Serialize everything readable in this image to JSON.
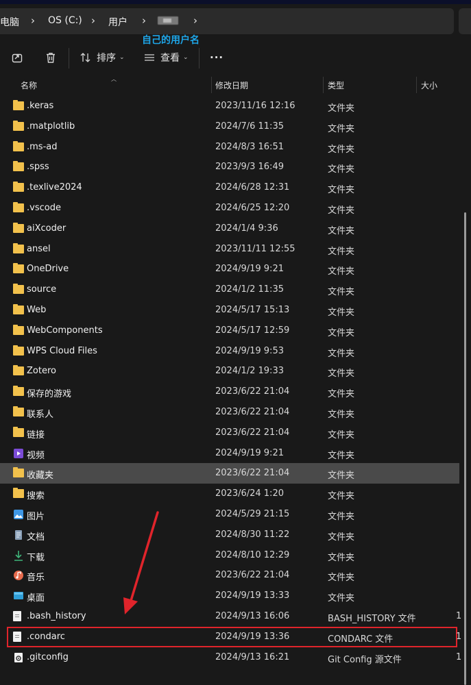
{
  "breadcrumb": {
    "items": [
      "电脑",
      "OS (C:)",
      "用户"
    ],
    "separator": "›"
  },
  "annotation": {
    "label": "自己的用户名"
  },
  "toolbar": {
    "sort_label": "排序",
    "view_label": "查看",
    "more_label": "···"
  },
  "columns": {
    "name": "名称",
    "date": "修改日期",
    "type": "类型",
    "size": "大小"
  },
  "colors": {
    "folder": "#f2c14c",
    "accent": "#1ea5e8",
    "highlight": "#e0242b",
    "selected_row": "#4a4a4a"
  },
  "rows": [
    {
      "name": ".keras",
      "date": "2023/11/16 12:16",
      "type": "文件夹",
      "size": "",
      "icon": "folder-icon"
    },
    {
      "name": ".matplotlib",
      "date": "2024/7/6 11:35",
      "type": "文件夹",
      "size": "",
      "icon": "folder-icon"
    },
    {
      "name": ".ms-ad",
      "date": "2024/8/3 16:51",
      "type": "文件夹",
      "size": "",
      "icon": "folder-icon"
    },
    {
      "name": ".spss",
      "date": "2023/9/3 16:49",
      "type": "文件夹",
      "size": "",
      "icon": "folder-icon"
    },
    {
      "name": ".texlive2024",
      "date": "2024/6/28 12:31",
      "type": "文件夹",
      "size": "",
      "icon": "folder-icon"
    },
    {
      "name": ".vscode",
      "date": "2024/6/25 12:20",
      "type": "文件夹",
      "size": "",
      "icon": "folder-icon"
    },
    {
      "name": "aiXcoder",
      "date": "2024/1/4 9:36",
      "type": "文件夹",
      "size": "",
      "icon": "folder-icon"
    },
    {
      "name": "ansel",
      "date": "2023/11/11 12:55",
      "type": "文件夹",
      "size": "",
      "icon": "folder-icon"
    },
    {
      "name": "OneDrive",
      "date": "2024/9/19 9:21",
      "type": "文件夹",
      "size": "",
      "icon": "folder-icon"
    },
    {
      "name": "source",
      "date": "2024/1/2 11:35",
      "type": "文件夹",
      "size": "",
      "icon": "folder-icon"
    },
    {
      "name": "Web",
      "date": "2024/5/17 15:13",
      "type": "文件夹",
      "size": "",
      "icon": "folder-icon"
    },
    {
      "name": "WebComponents",
      "date": "2024/5/17 12:59",
      "type": "文件夹",
      "size": "",
      "icon": "folder-icon"
    },
    {
      "name": "WPS Cloud Files",
      "date": "2024/9/19 9:53",
      "type": "文件夹",
      "size": "",
      "icon": "folder-icon"
    },
    {
      "name": "Zotero",
      "date": "2024/1/2 19:33",
      "type": "文件夹",
      "size": "",
      "icon": "folder-icon"
    },
    {
      "name": "保存的游戏",
      "date": "2023/6/22 21:04",
      "type": "文件夹",
      "size": "",
      "icon": "folder-icon"
    },
    {
      "name": "联系人",
      "date": "2023/6/22 21:04",
      "type": "文件夹",
      "size": "",
      "icon": "folder-icon"
    },
    {
      "name": "链接",
      "date": "2023/6/22 21:04",
      "type": "文件夹",
      "size": "",
      "icon": "folder-icon"
    },
    {
      "name": "视频",
      "date": "2024/9/19 9:21",
      "type": "文件夹",
      "size": "",
      "icon": "video-icon"
    },
    {
      "name": "收藏夹",
      "date": "2023/6/22 21:04",
      "type": "文件夹",
      "size": "",
      "icon": "folder-icon",
      "selected": true
    },
    {
      "name": "搜索",
      "date": "2023/6/24 1:20",
      "type": "文件夹",
      "size": "",
      "icon": "folder-icon"
    },
    {
      "name": "图片",
      "date": "2024/5/29 21:15",
      "type": "文件夹",
      "size": "",
      "icon": "pictures-icon"
    },
    {
      "name": "文档",
      "date": "2024/8/30 11:22",
      "type": "文件夹",
      "size": "",
      "icon": "documents-icon"
    },
    {
      "name": "下载",
      "date": "2024/8/10 12:29",
      "type": "文件夹",
      "size": "",
      "icon": "download-icon"
    },
    {
      "name": "音乐",
      "date": "2023/6/22 21:04",
      "type": "文件夹",
      "size": "",
      "icon": "music-icon"
    },
    {
      "name": "桌面",
      "date": "2024/9/19 13:33",
      "type": "文件夹",
      "size": "",
      "icon": "desktop-icon"
    },
    {
      "name": ".bash_history",
      "date": "2024/9/13 16:06",
      "type": "BASH_HISTORY 文件",
      "size": "1",
      "icon": "file-icon"
    },
    {
      "name": ".condarc",
      "date": "2024/9/19 13:36",
      "type": "CONDARC 文件",
      "size": "1",
      "icon": "file-icon",
      "highlighted": true
    },
    {
      "name": ".gitconfig",
      "date": "2024/9/13 16:21",
      "type": "Git Config 源文件",
      "size": "1",
      "icon": "gitconfig-icon"
    }
  ]
}
